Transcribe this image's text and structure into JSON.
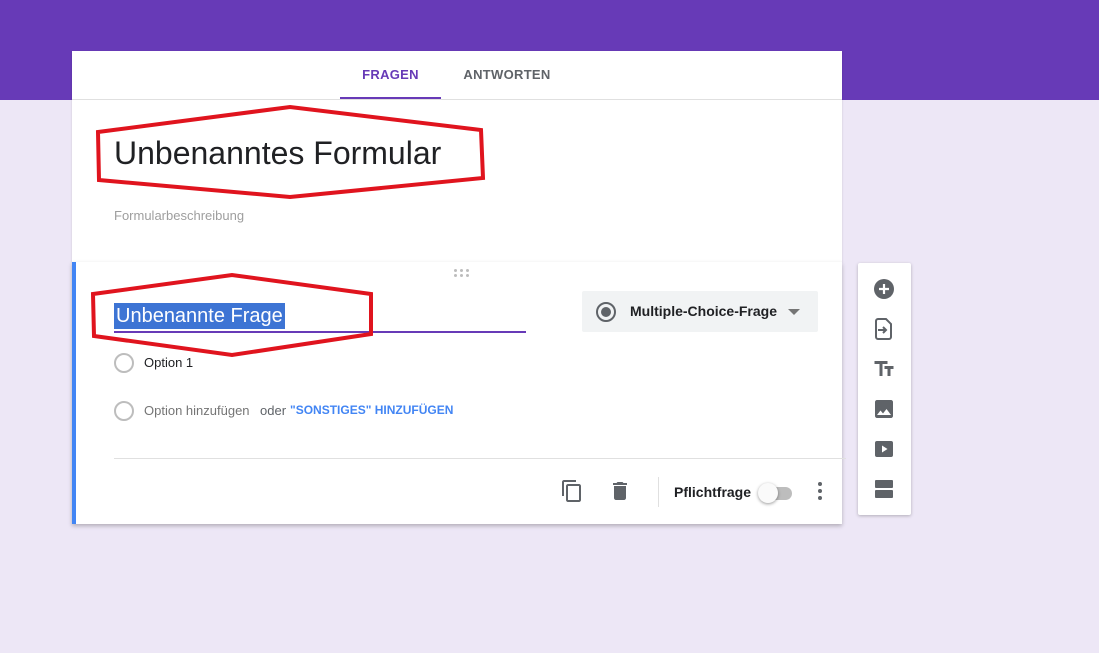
{
  "tabs": [
    {
      "label": "FRAGEN",
      "active": true
    },
    {
      "label": "ANTWORTEN",
      "active": false
    }
  ],
  "form": {
    "title": "Unbenanntes Formular",
    "description_placeholder": "Formularbeschreibung"
  },
  "question": {
    "title": "Unbenannte Frage",
    "type": "Multiple-Choice-Frage",
    "options": [
      "Option 1"
    ],
    "add_option": "Option hinzufügen",
    "or": "oder",
    "add_other": "\"SONSTIGES\" HINZUFÜGEN",
    "required_label": "Pflichtfrage",
    "required": false
  },
  "toolbar": {
    "icons": [
      "add-question-icon",
      "import-question-icon",
      "title-text-icon",
      "image-icon",
      "video-icon",
      "section-icon"
    ]
  },
  "colors": {
    "header": "#673ab7",
    "background": "#ede7f6",
    "accent": "#4285f4",
    "annotation": "#e0141e"
  }
}
